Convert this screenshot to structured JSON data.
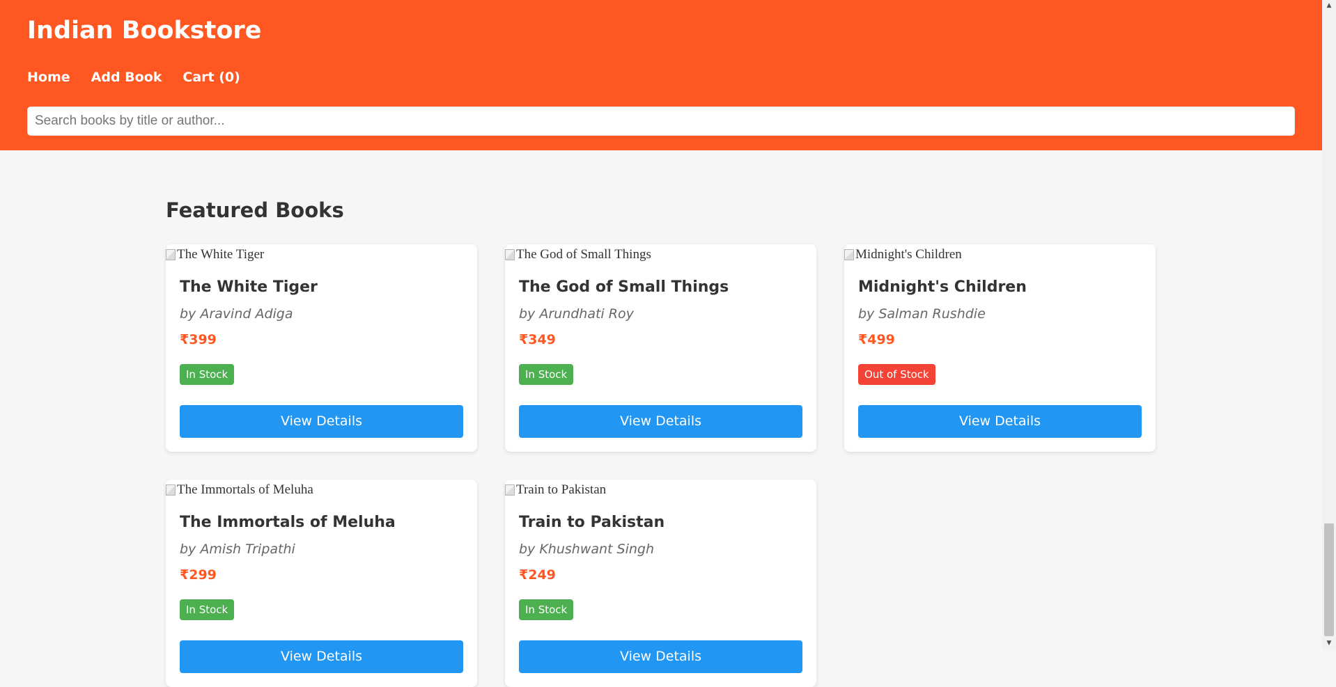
{
  "header": {
    "title": "Indian Bookstore",
    "nav": [
      "Home",
      "Add Book",
      "Cart (0)"
    ]
  },
  "search": {
    "placeholder": "Search books by title or author..."
  },
  "main": {
    "section_title": "Featured Books",
    "books": [
      {
        "image_alt": "The White Tiger",
        "title": "The White Tiger",
        "author": "by Aravind Adiga",
        "price": "₹399",
        "stock": "In Stock",
        "in_stock": true,
        "button": "View Details"
      },
      {
        "image_alt": "The God of Small Things",
        "title": "The God of Small Things",
        "author": "by Arundhati Roy",
        "price": "₹349",
        "stock": "In Stock",
        "in_stock": true,
        "button": "View Details"
      },
      {
        "image_alt": "Midnight's Children",
        "title": "Midnight's Children",
        "author": "by Salman Rushdie",
        "price": "₹499",
        "stock": "Out of Stock",
        "in_stock": false,
        "button": "View Details"
      },
      {
        "image_alt": "The Immortals of Meluha",
        "title": "The Immortals of Meluha",
        "author": "by Amish Tripathi",
        "price": "₹299",
        "stock": "In Stock",
        "in_stock": true,
        "button": "View Details"
      },
      {
        "image_alt": "Train to Pakistan",
        "title": "Train to Pakistan",
        "author": "by Khushwant Singh",
        "price": "₹249",
        "stock": "In Stock",
        "in_stock": true,
        "button": "View Details"
      }
    ]
  },
  "colors": {
    "header_bg": "#ff5722",
    "price": "#ff5722",
    "in_stock": "#4caf50",
    "out_of_stock": "#f44336",
    "button": "#2196f3"
  },
  "icons": {
    "broken_image": "broken-image-icon",
    "scroll_up": "scroll-up-arrow-icon",
    "scroll_down": "scroll-down-arrow-icon"
  }
}
